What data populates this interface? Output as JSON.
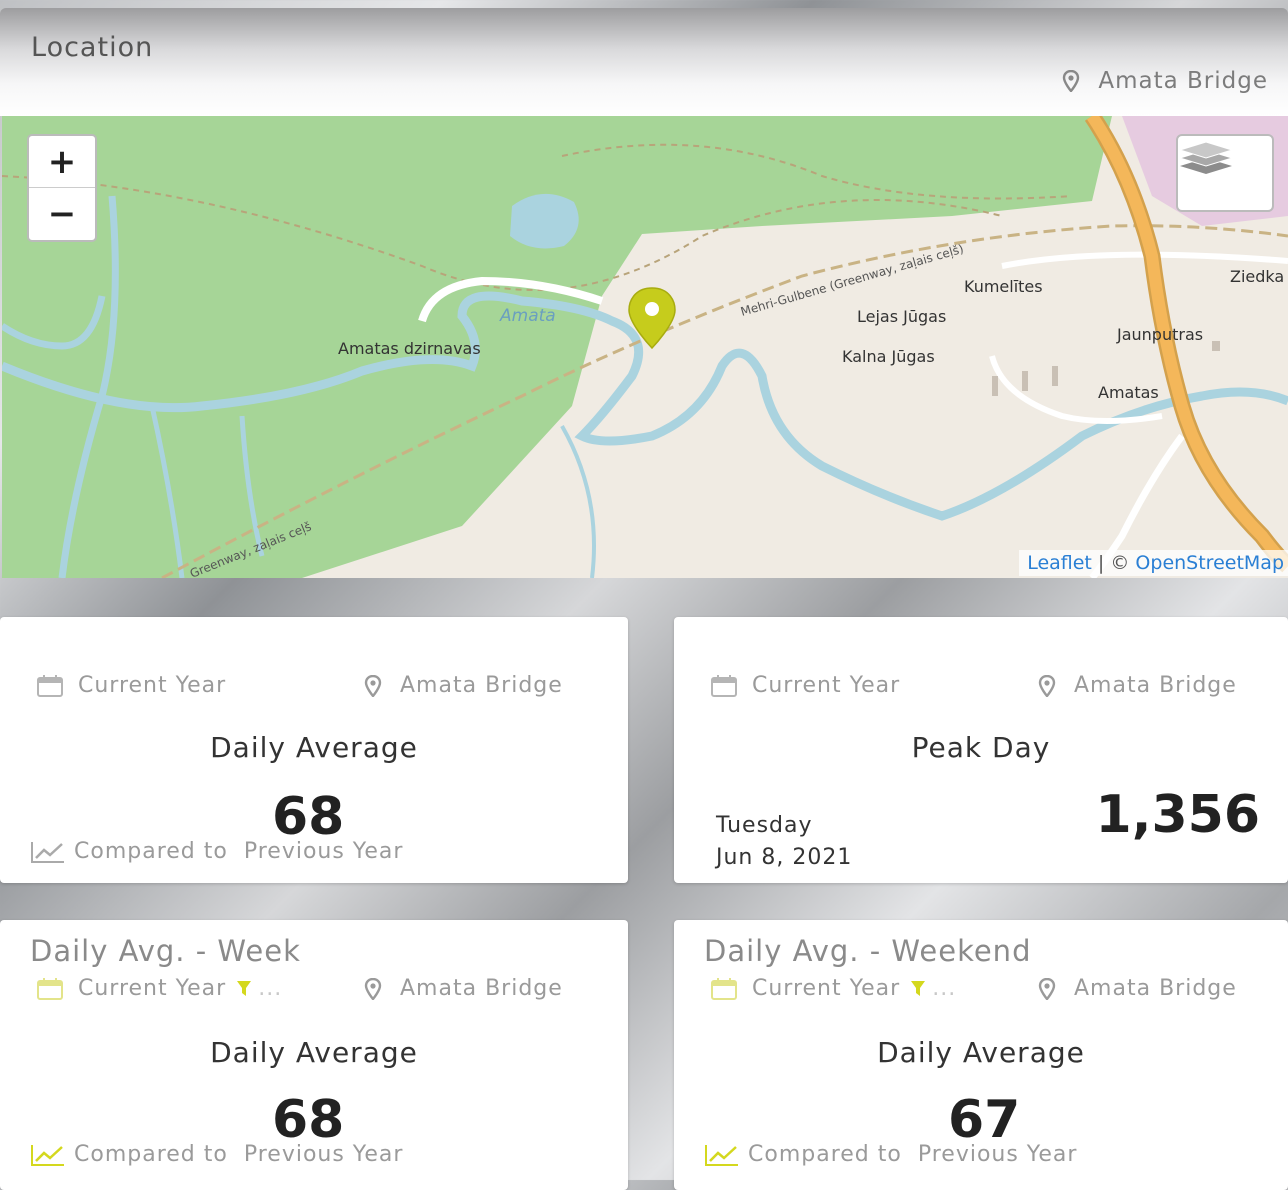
{
  "header": {
    "title": "Location",
    "location": "Amata Bridge"
  },
  "map": {
    "zoom_in": "+",
    "zoom_out": "−",
    "labels": {
      "amatas_dzirnavas": "Amatas dzirnavas",
      "amata_river": "Amata",
      "greenway": "Mehri-Gulbene (Greenway, zaļais ceļš)",
      "greenway_lower": "Greenway, zaļais ceļš",
      "kumelites": "Kumelītes",
      "lejas_jugas": "Lejas Jūgas",
      "kalna_jugas": "Kalna Jūgas",
      "jaunputras": "Jaunputras",
      "amatas": "Amatas",
      "ziedkalni": "Ziedka"
    },
    "attribution": {
      "leaflet": "Leaflet",
      "separator": " | © ",
      "osm": "OpenStreetMap"
    },
    "colors": {
      "forest": "#a6d597",
      "land": "#f0ebe3",
      "water": "#aad3df",
      "highway": "#f4b75a",
      "marker": "#c6cc1c"
    }
  },
  "cards": [
    {
      "period": "Current Year",
      "location": "Amata Bridge",
      "title": "Daily Average",
      "value": "68",
      "compare_label": "Compared to",
      "compare_period": "Previous Year"
    },
    {
      "period": "Current Year",
      "location": "Amata Bridge",
      "title": "Peak Day",
      "value": "1,356",
      "day": "Tuesday",
      "date": "Jun 8, 2021"
    },
    {
      "heading": "Daily Avg. - Week",
      "period": "Current Year",
      "filter_more": "...",
      "location": "Amata Bridge",
      "title": "Daily Average",
      "value": "68",
      "compare_label": "Compared to",
      "compare_period": "Previous Year"
    },
    {
      "heading": "Daily Avg. - Weekend",
      "period": "Current Year",
      "filter_more": "...",
      "location": "Amata Bridge",
      "title": "Daily Average",
      "value": "67",
      "compare_label": "Compared to",
      "compare_period": "Previous Year"
    }
  ],
  "accent_color": "#d4d81e"
}
